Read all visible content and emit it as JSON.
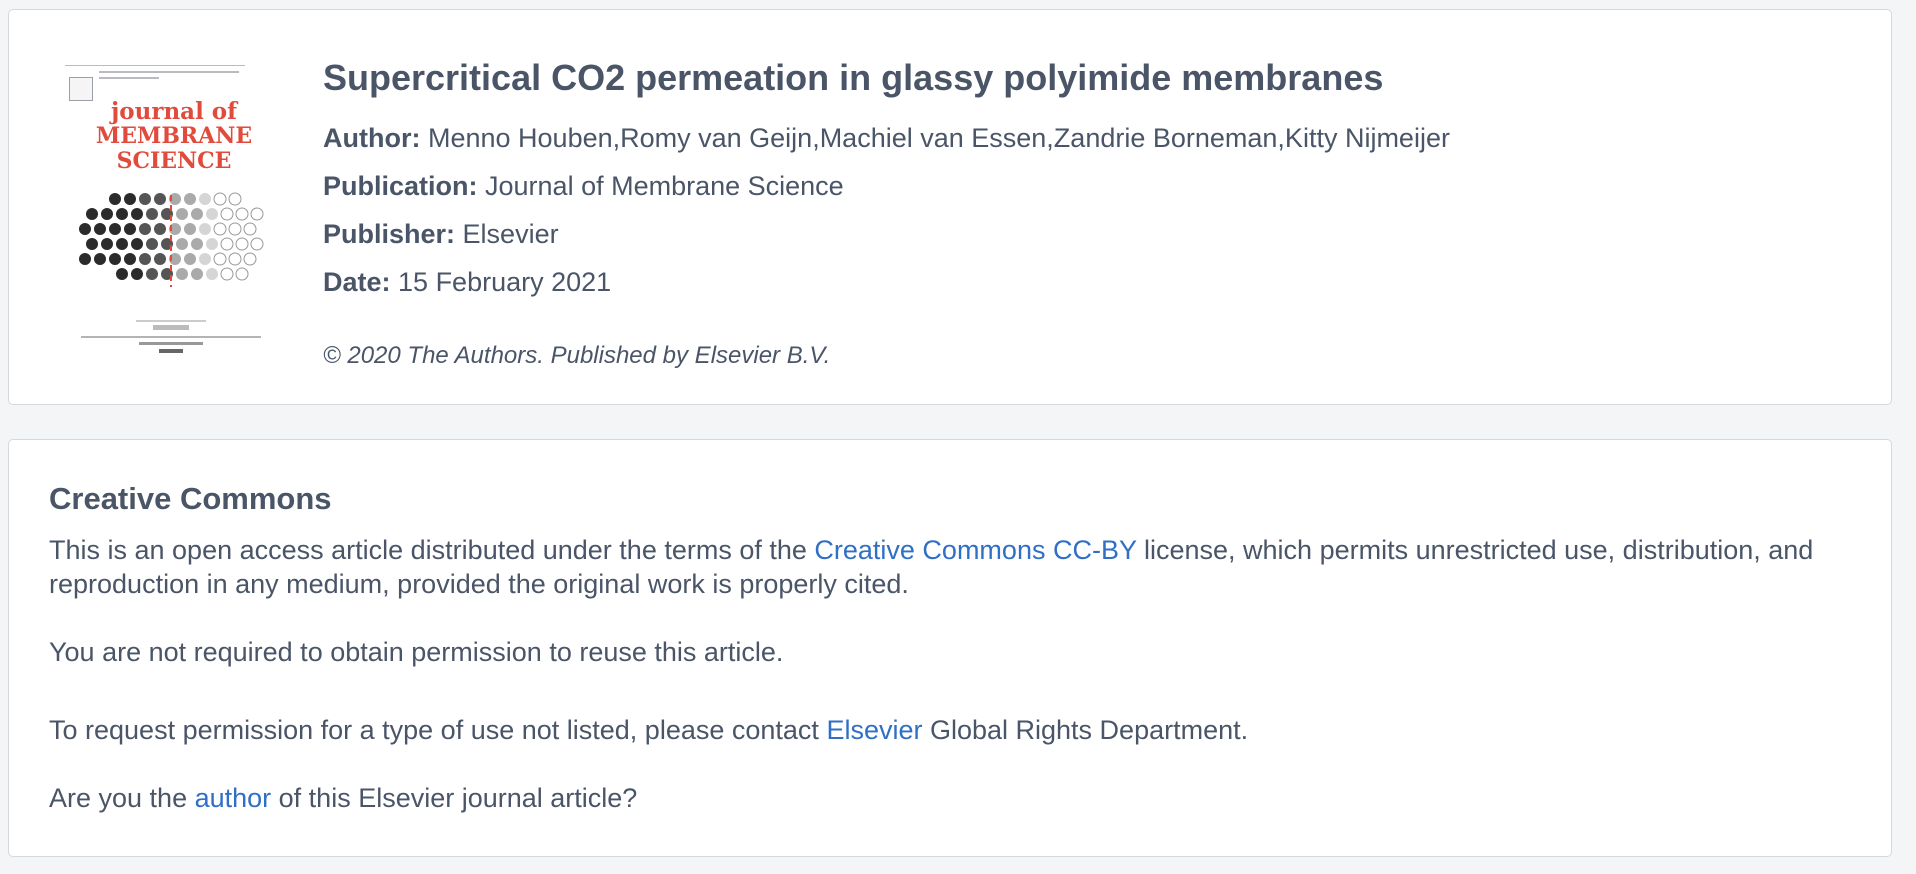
{
  "article": {
    "title": "Supercritical CO2 permeation in glassy polyimide membranes",
    "author_label": "Author:",
    "authors": "Menno Houben,Romy van Geijn,Machiel van Essen,Zandrie Borneman,Kitty Nijmeijer",
    "publication_label": "Publication:",
    "publication": "Journal of Membrane Science",
    "publisher_label": "Publisher:",
    "publisher": "Elsevier",
    "date_label": "Date:",
    "date": "15 February 2021",
    "copyright": "© 2020 The Authors. Published by Elsevier B.V.",
    "cover": {
      "title_line1": "journal of",
      "title_line2": "MEMBRANE",
      "title_line3": "SCIENCE"
    }
  },
  "license": {
    "heading": "Creative Commons",
    "p1_before": "This is an open access article distributed under the terms of the ",
    "p1_link": "Creative Commons CC-BY",
    "p1_after": " license, which permits unrestricted use, distribution, and reproduction in any medium, provided the original work is properly cited.",
    "p2": "You are not required to obtain permission to reuse this article.",
    "p3_before": "To request permission for a type of use not listed, please contact ",
    "p3_link": "Elsevier",
    "p3_after": " Global Rights Department.",
    "p4_before": "Are you the ",
    "p4_link": "author",
    "p4_after": " of this Elsevier journal article?"
  },
  "colors": {
    "link": "#2f6fc6",
    "text": "#4a5568",
    "cover_title": "#e14b3c"
  }
}
